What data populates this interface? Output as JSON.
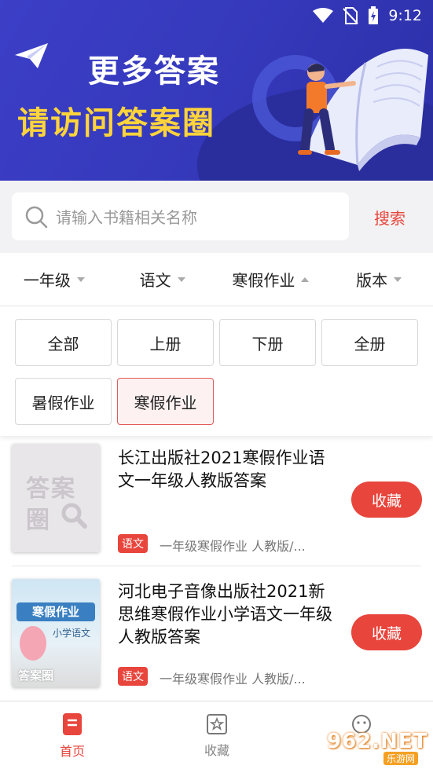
{
  "status_bar": {
    "time": "9:12"
  },
  "banner": {
    "line1": "更多答案",
    "line2": "请访问答案圈"
  },
  "search": {
    "placeholder": "请输入书籍相关名称",
    "button": "搜索"
  },
  "filters": [
    {
      "label": "一年级",
      "open": false
    },
    {
      "label": "语文",
      "open": false
    },
    {
      "label": "寒假作业",
      "open": true
    },
    {
      "label": "版本",
      "open": false
    }
  ],
  "options": [
    "全部",
    "上册",
    "下册",
    "全册",
    "暑假作业",
    "寒假作业"
  ],
  "selected_option": "寒假作业",
  "books": [
    {
      "title": "长江出版社2021寒假作业语文一年级人教版答案",
      "subject": "语文",
      "meta": "一年级寒假作业   人教版/...",
      "fav": "收藏",
      "cover_text": [
        "答案",
        "圈"
      ]
    },
    {
      "title": "河北电子音像出版社2021新思维寒假作业小学语文一年级人教版答案",
      "subject": "语文",
      "meta": "一年级寒假作业   人教版/...",
      "fav": "收藏",
      "cover_text": [
        "寒假作业",
        "小学语文",
        "答案圈"
      ]
    }
  ],
  "nav": {
    "home": "首页",
    "favorites": "收藏"
  },
  "watermark": {
    "main": "962.NET",
    "sub": "乐游网"
  },
  "colors": {
    "accent": "#e8453c",
    "banner": "#3438b9",
    "headline_yellow": "#ffd43b"
  }
}
